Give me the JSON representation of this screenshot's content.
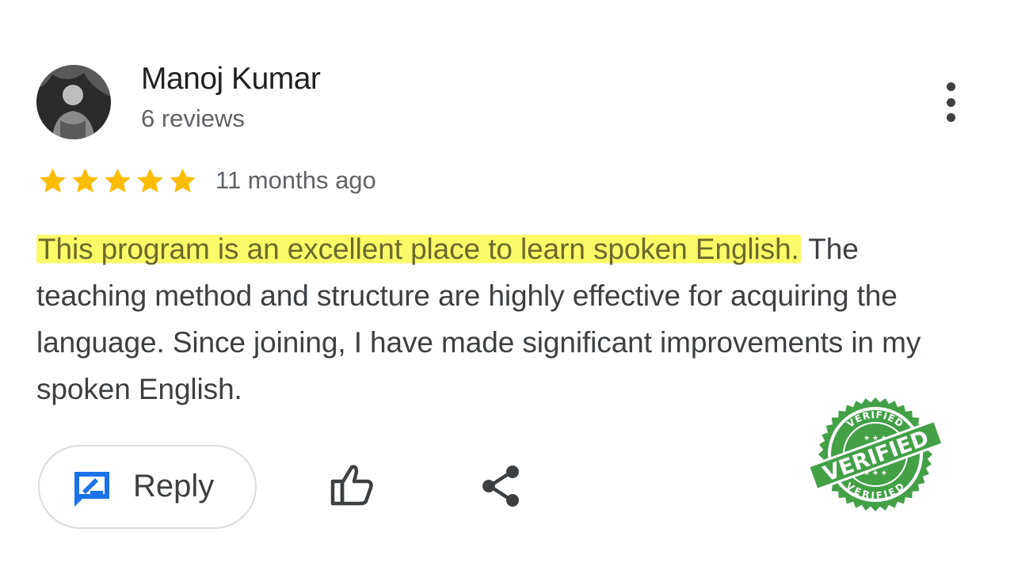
{
  "reviewer": {
    "name": "Manoj Kumar",
    "review_count": "6 reviews"
  },
  "rating": {
    "stars": 5,
    "max_stars": 5,
    "star_color": "#fbbc04",
    "time_ago": "11 months ago"
  },
  "review": {
    "highlighted_text": "This program is an excellent place to learn spoken English.",
    "rest_text": " The teaching method and structure are highly effective for acquiring the language. Since joining, I have made significant improvements in my spoken English.",
    "highlight_color": "#fbfb6a"
  },
  "actions": {
    "reply_label": "Reply",
    "reply_icon": "reply-icon",
    "like_icon": "thumb-up-icon",
    "share_icon": "share-icon",
    "more_icon": "more-vert-icon"
  },
  "stamp": {
    "text": "VERIFIED",
    "color": "#43a047"
  },
  "colors": {
    "accent_blue": "#1a73e8",
    "text_primary": "#202124",
    "text_secondary": "#5f6368"
  }
}
